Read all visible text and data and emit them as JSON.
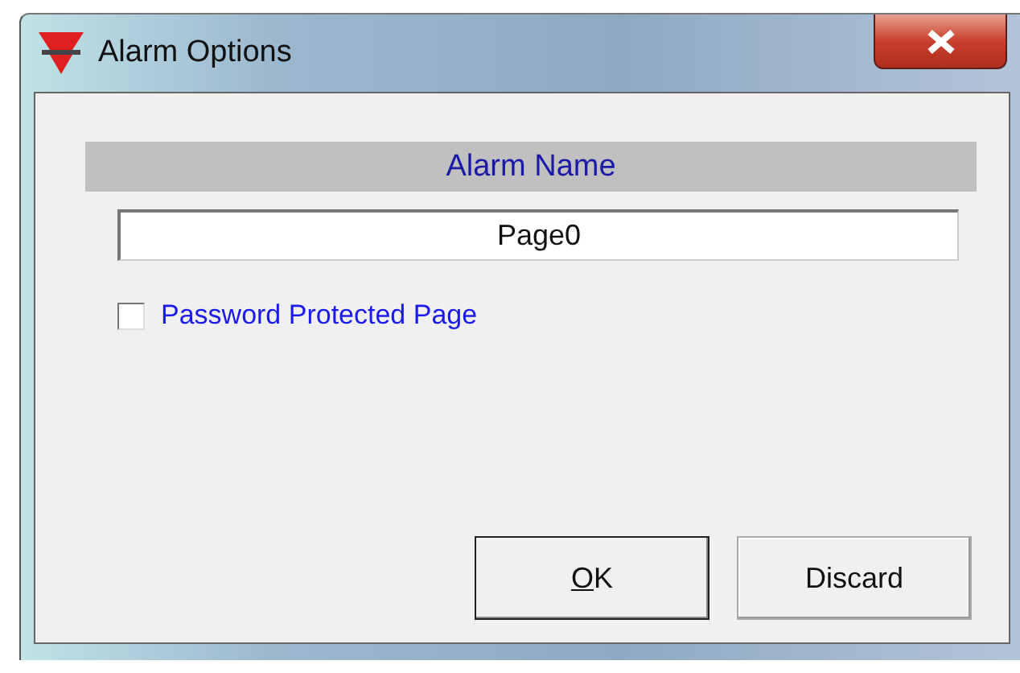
{
  "window": {
    "title": "Alarm Options"
  },
  "header": "Alarm Name",
  "name_field": {
    "value": "Page0"
  },
  "checkbox": {
    "label": "Password Protected Page",
    "checked": false
  },
  "buttons": [
    {
      "label": "OK",
      "default": true,
      "first_letter_underlined": true
    },
    {
      "label": "Discard",
      "default": false
    }
  ]
}
